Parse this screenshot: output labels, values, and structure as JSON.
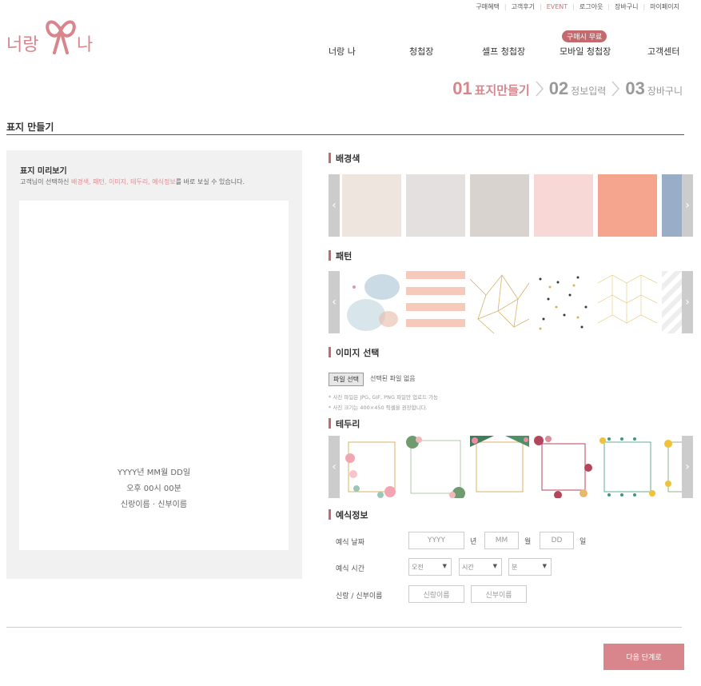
{
  "top_links": [
    "구매혜택",
    "고객후기",
    "EVENT",
    "로그아웃",
    "장바구니",
    "마이페이지"
  ],
  "logo": {
    "left": "너랑",
    "right": "나"
  },
  "nav": {
    "items": [
      "너랑 나",
      "청첩장",
      "셀프 청첩장",
      "모바일 청첩장",
      "고객센터"
    ],
    "badge": "구매시 무료"
  },
  "steps": [
    {
      "num": "01",
      "label": "표지만들기"
    },
    {
      "num": "02",
      "label": "정보입력"
    },
    {
      "num": "03",
      "label": "장바구니"
    }
  ],
  "section_title": "표지 만들기",
  "preview": {
    "title": "표지 미리보기",
    "desc_prefix": "고객님이 선택하신 ",
    "desc_highlight": "배경색, 패턴, 이미지, 테두리, 예식정보",
    "desc_suffix": "를 바로 보실 수 있습니다.",
    "line1": "YYYY년 MM월 DD일",
    "line2": "오후 00시 00분",
    "line3": "신랑이름 · 신부이름"
  },
  "background": {
    "title": "배경색",
    "colors": [
      "#efe5df",
      "#e4e0df",
      "#d9d3d0",
      "#f8d7d7",
      "#f5a48e",
      "#99adc7"
    ]
  },
  "pattern": {
    "title": "패턴",
    "items": [
      "watercolor",
      "pink-stripes",
      "gold-geometric",
      "terrazzo-dots",
      "gold-hexagon",
      "white-waves"
    ]
  },
  "image": {
    "title": "이미지 선택",
    "button": "파일 선택",
    "status": "선택된 파일 없음",
    "note1": "* 사진 파일은 JPG, GIF, PNG 파일만 업로드 가능",
    "note2": "* 사진 크기는 400×450 픽셀을 권장합니다."
  },
  "border": {
    "title": "테두리",
    "items": [
      "floral-pink",
      "leaf-corner",
      "tropical",
      "rose-frame",
      "leaf-line",
      "yellow-flower"
    ]
  },
  "wedding": {
    "title": "예식정보",
    "date_label": "예식 날짜",
    "year_ph": "YYYY",
    "year_unit": "년",
    "month_ph": "MM",
    "month_unit": "월",
    "day_ph": "DD",
    "day_unit": "일",
    "time_label": "예식 시간",
    "ampm": "오전",
    "hour": "시간",
    "minute": "분",
    "name_label": "신랑 / 신부이름",
    "groom_ph": "신랑이름",
    "bride_ph": "신부이름"
  },
  "next_button": "다음 단계로",
  "colors": {
    "accent": "#d8858c",
    "badge": "#c46a6e"
  }
}
